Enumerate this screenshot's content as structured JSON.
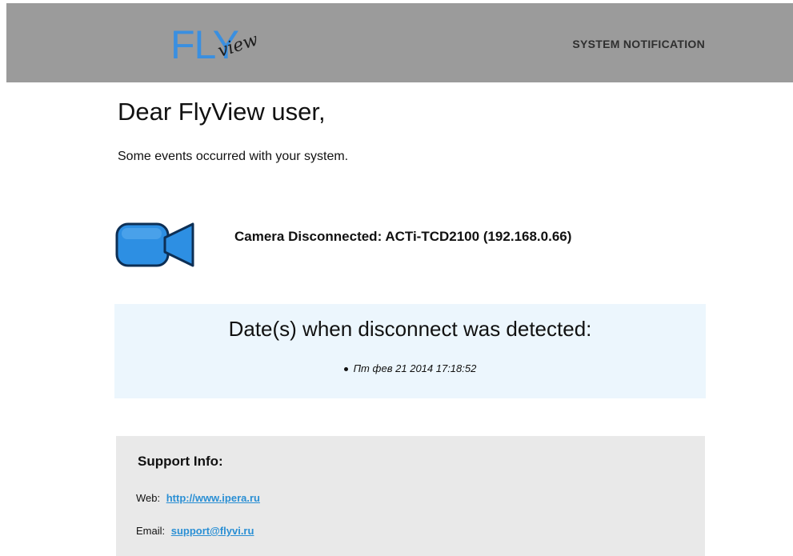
{
  "header": {
    "logo_main": "FLY",
    "logo_script": "view",
    "title": "SYSTEM NOTIFICATION"
  },
  "message": {
    "greeting": "Dear FlyView user,",
    "intro": "Some events occurred with your system."
  },
  "event": {
    "icon": "camera-icon",
    "text": "Camera Disconnected: ACTi-TCD2100 (192.168.0.66)"
  },
  "dates": {
    "title": "Date(s) when disconnect was detected:",
    "items": [
      "Пт фев 21 2014 17:18:52"
    ]
  },
  "support": {
    "title": "Support Info:",
    "web_label": "Web:",
    "web_link": "http://www.ipera.ru",
    "email_label": "Email:",
    "email_link": "support@flyvi.ru"
  },
  "colors": {
    "header_bg": "#9b9b9b",
    "logo_blue": "#3a8fe0",
    "camera_blue": "#2d8fe3",
    "dates_bg": "#ecf6fd",
    "support_bg": "#e9e9e9",
    "link": "#2a8fd4"
  }
}
